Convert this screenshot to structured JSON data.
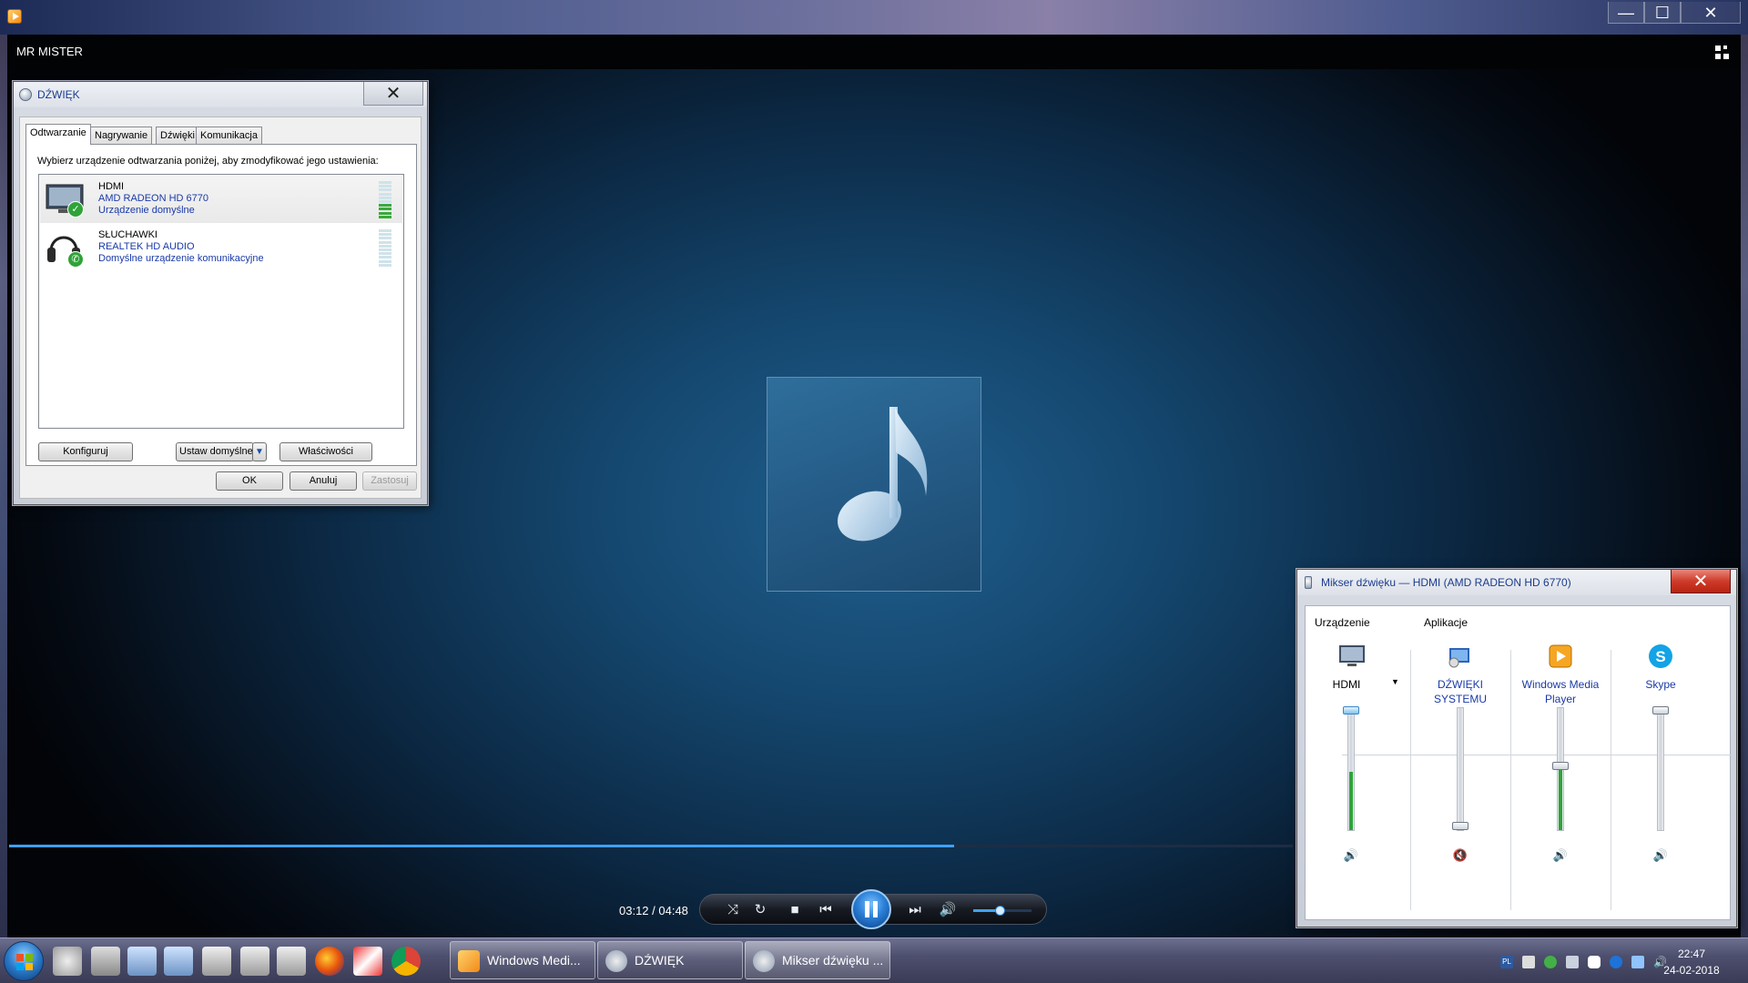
{
  "wmp": {
    "now_playing": "MR MISTER",
    "time": "03:12 / 04:48",
    "seek_progress": 0.736,
    "volume_level": 0.45,
    "window_buttons": {
      "minimize": "—",
      "maximize": "☐",
      "close": "✕"
    }
  },
  "sound_dialog": {
    "title": "DŹWIĘK",
    "close_glyph": "✕",
    "tabs": [
      "Odtwarzanie",
      "Nagrywanie",
      "Dźwięki",
      "Komunikacja"
    ],
    "active_tab": 0,
    "instruction": "Wybierz urządzenie odtwarzania poniżej, aby zmodyfikować jego ustawienia:",
    "devices": [
      {
        "name": "HDMI",
        "driver": "AMD RADEON HD 6770",
        "status": "Urządzenie domyślne",
        "icon": "monitor-icon",
        "level": 0.4
      },
      {
        "name": "SŁUCHAWKI",
        "driver": "REALTEK HD AUDIO",
        "status": "Domyślne urządzenie komunikacyjne",
        "icon": "headphones-icon",
        "level": 0
      }
    ],
    "buttons": {
      "configure": "Konfiguruj",
      "set_default": "Ustaw domyślne",
      "properties": "Właściwości",
      "ok": "OK",
      "cancel": "Anuluj",
      "apply": "Zastosuj"
    }
  },
  "mixer_dialog": {
    "title": "Mikser dźwięku — HDMI (AMD RADEON HD 6770)",
    "close_glyph": "✕",
    "device_group_label": "Urządzenie",
    "apps_group_label": "Aplikacje",
    "channels": [
      {
        "name_line1": "HDMI",
        "name_line2": "",
        "icon": "monitor-icon",
        "volume": 1.0,
        "peak": 0.48,
        "muted": false,
        "is_device": true
      },
      {
        "name_line1": "DŹWIĘKI",
        "name_line2": "SYSTEMU",
        "icon": "system-sounds-icon",
        "volume": 0.0,
        "peak": 0.0,
        "muted": true,
        "is_device": false
      },
      {
        "name_line1": "Windows Media",
        "name_line2": "Player",
        "icon": "wmp-icon",
        "volume": 0.52,
        "peak": 0.5,
        "muted": false,
        "is_device": false
      },
      {
        "name_line1": "Skype",
        "name_line2": "",
        "icon": "skype-icon",
        "volume": 1.0,
        "peak": 0.0,
        "muted": false,
        "is_device": false
      }
    ]
  },
  "taskbar": {
    "tasks": [
      {
        "label": "Windows Medi...",
        "icon": "wmp-icon"
      },
      {
        "label": "DŹWIĘK",
        "icon": "speaker-icon"
      },
      {
        "label": "Mikser dźwięku ...",
        "icon": "speaker-icon"
      }
    ],
    "active_task": 2,
    "clock_time": "22:47",
    "clock_date": "24-02-2018",
    "tray_lang": "PL",
    "colors": {
      "accent": "#3fa1ff",
      "level_green": "#2fa338",
      "close_red": "#cf3b2a"
    }
  }
}
